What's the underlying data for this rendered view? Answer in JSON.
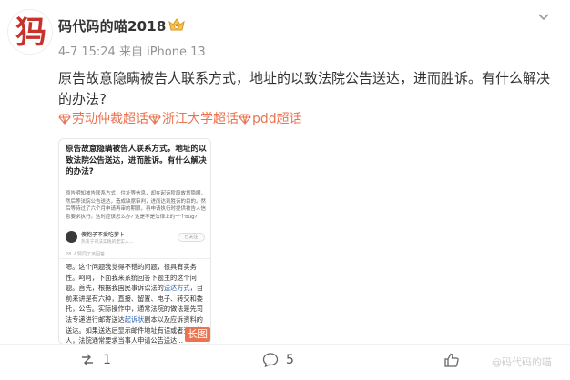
{
  "post": {
    "avatar_char": "犸",
    "username": "码代码的喵2018",
    "meta": "4-7 15:24 来自 iPhone 13",
    "content": "原告故意隐瞒被告人联系方式，地址的以致法院公告送达，进而胜诉。有什么解决的办法?",
    "tags": [
      "劳动仲裁超话",
      "浙江大学超话",
      "pdd超话"
    ],
    "tag_color": "#eb7350"
  },
  "long_image": {
    "title": "原告故意隐瞒被告人联系方式，地址的以致法院公告送达，进而胜诉。有什么解决的办法?",
    "body": "原告明知被告联系方式，住址等信息，却在起诉阶段故意隐瞒，然后等法院公告送达，造成缺席审判，进而达到胜诉的目的。然后等待过了六个月申请再审的期限，再申请执行时提供被告人信息要求执行。这时应该怎么办? 这是不是法律上的一个bug?",
    "author_name": "傻狍子不爱吃萝卜",
    "author_sub": "热衷于司法实践的老实人...",
    "follow_label": "已关注",
    "approve_text": "28 人赞同了该回答",
    "answer_pre": "嗯。这个问题我觉得不错的问题，很具有实务性。呵呵，下面我来系统回答下题主的这个问题。首先，根据我国民事诉讼法的",
    "answer_link1": "送达方式",
    "answer_mid": "，目前来讲是有六种，直接、留置、电子、转交和委托，公告。实际操作中，通常法院的做法是先司法专递进行邮寄送达",
    "answer_link2": "起诉状",
    "answer_post": "副本以及应诉资料的送达。如果送达后显示邮件地址有误或者查无此人，法院通常要求当事人申请公告送达...",
    "badge": "长图"
  },
  "actions": {
    "share_count": "1",
    "comment_count": "5",
    "like_count": ""
  },
  "watermark": "@码代码的喵"
}
